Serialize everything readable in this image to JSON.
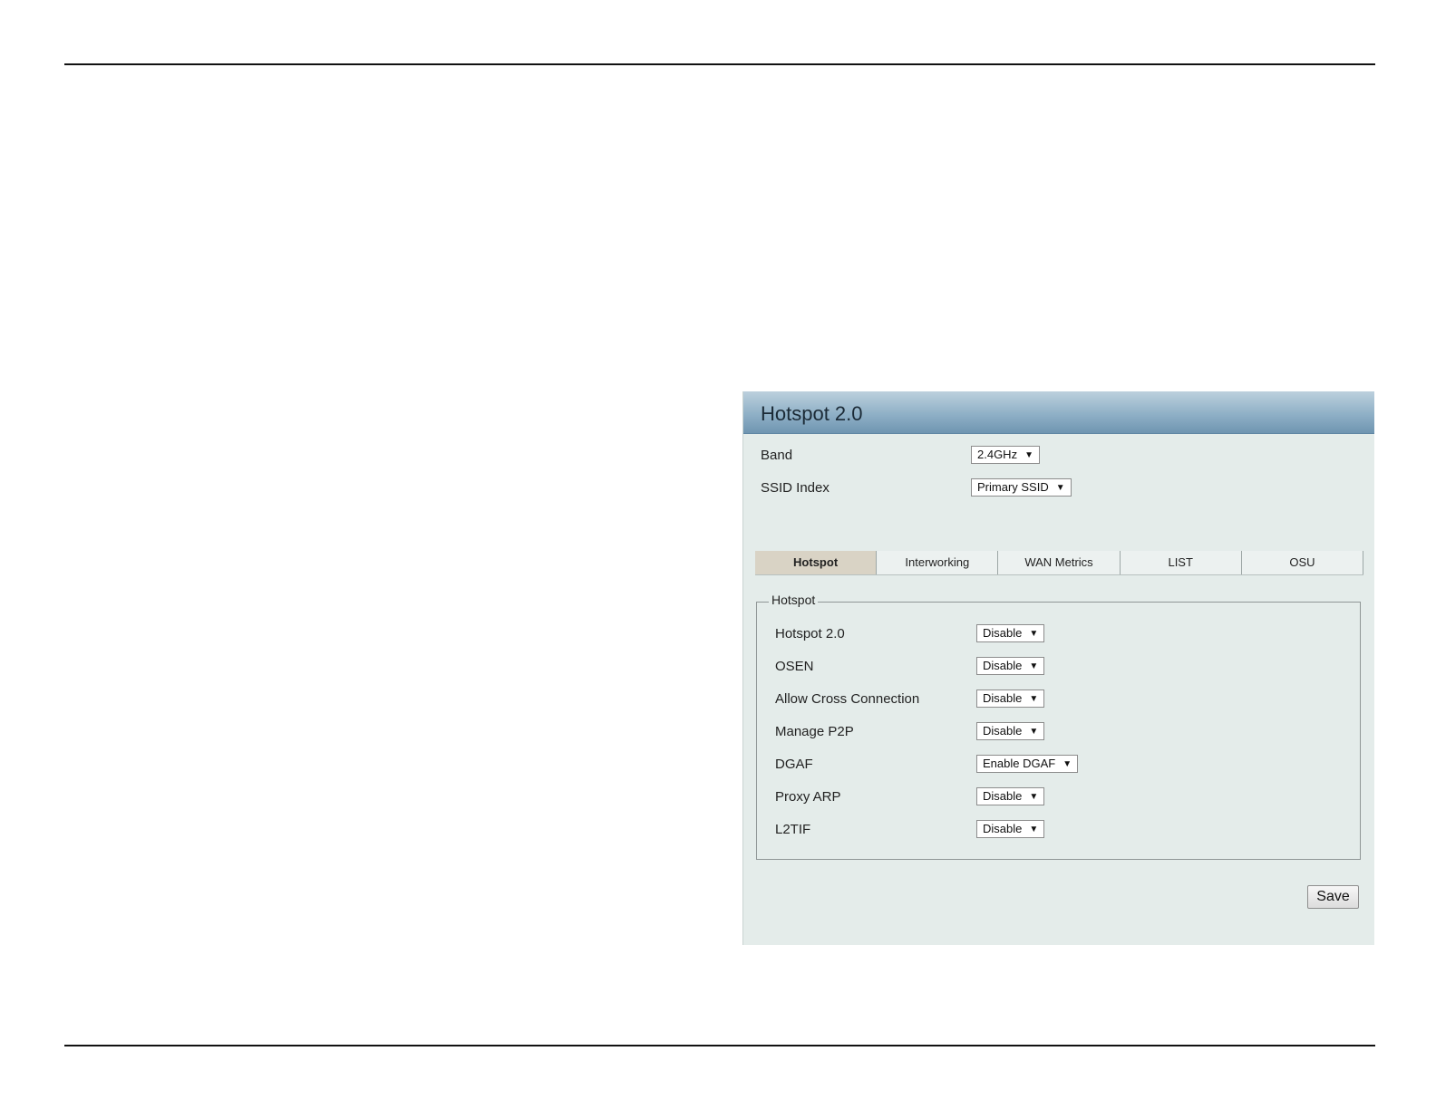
{
  "panel": {
    "title": "Hotspot 2.0",
    "band": {
      "label": "Band",
      "value": "2.4GHz"
    },
    "ssid_index": {
      "label": "SSID Index",
      "value": "Primary SSID"
    },
    "tabs": [
      {
        "label": "Hotspot",
        "active": true
      },
      {
        "label": "Interworking",
        "active": false
      },
      {
        "label": "WAN Metrics",
        "active": false
      },
      {
        "label": "LIST",
        "active": false
      },
      {
        "label": "OSU",
        "active": false
      }
    ],
    "fieldset": {
      "legend": "Hotspot",
      "rows": [
        {
          "label": "Hotspot 2.0",
          "value": "Disable"
        },
        {
          "label": "OSEN",
          "value": "Disable"
        },
        {
          "label": "Allow Cross Connection",
          "value": "Disable"
        },
        {
          "label": "Manage P2P",
          "value": "Disable"
        },
        {
          "label": "DGAF",
          "value": "Enable DGAF"
        },
        {
          "label": "Proxy ARP",
          "value": "Disable"
        },
        {
          "label": "L2TIF",
          "value": "Disable"
        }
      ]
    },
    "save_label": "Save"
  },
  "icons": {
    "dropdown": "chevron-down-icon"
  }
}
